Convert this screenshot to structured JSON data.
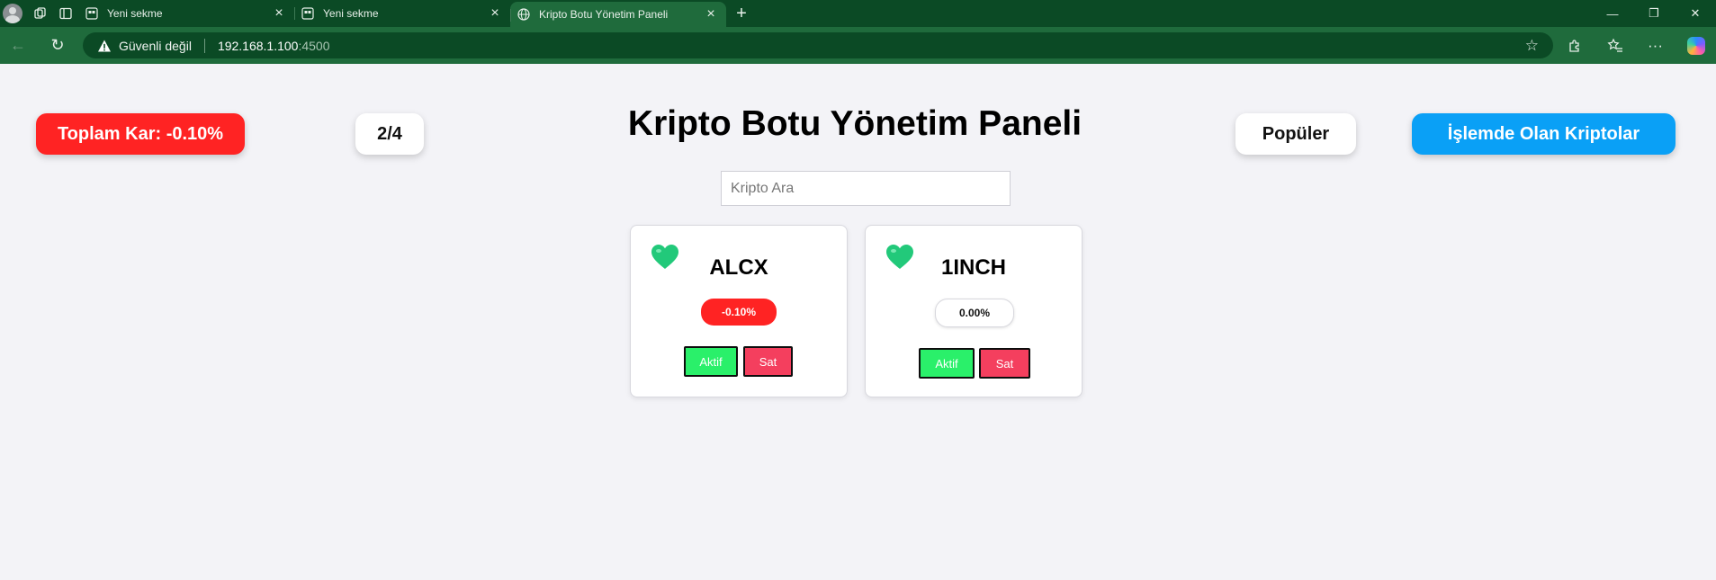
{
  "browser": {
    "tabs": [
      {
        "title": "Yeni sekme",
        "active": false
      },
      {
        "title": "Yeni sekme",
        "active": false
      },
      {
        "title": "Kripto Botu Yönetim Paneli",
        "active": true
      }
    ],
    "security_label": "Güvenli değil",
    "url_host": "192.168.1.100",
    "url_port": ":4500"
  },
  "header": {
    "total_profit": "Toplam Kar: -0.10%",
    "page_indicator": "2/4",
    "title": "Kripto Botu Yönetim Paneli",
    "popular_label": "Popüler",
    "trading_label": "İşlemde Olan Kriptolar"
  },
  "search": {
    "placeholder": "Kripto Ara",
    "value": ""
  },
  "cards": [
    {
      "name": "ALCX",
      "change": "-0.10%",
      "change_state": "negative",
      "active_label": "Aktif",
      "sell_label": "Sat"
    },
    {
      "name": "1INCH",
      "change": "0.00%",
      "change_state": "neutral",
      "active_label": "Aktif",
      "sell_label": "Sat"
    }
  ],
  "colors": {
    "browser_frame": "#0b4a25",
    "profit_negative": "#ff2323",
    "trading_button": "#0aa0f6",
    "active_button": "#2af06a",
    "sell_button": "#f43f5e",
    "heart": "#22c97a"
  }
}
